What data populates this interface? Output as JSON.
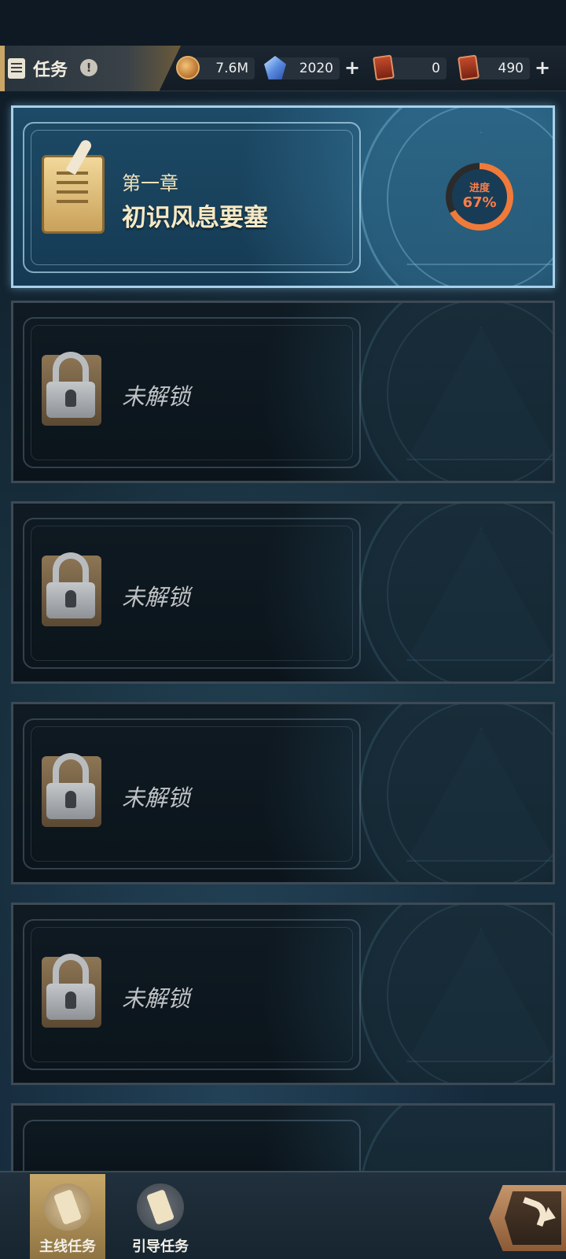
{
  "header": {
    "title": "任务",
    "info_symbol": "!",
    "resources": [
      {
        "icon": "coin-icon",
        "value": "7.6M",
        "has_plus": false
      },
      {
        "icon": "gem-icon",
        "value": "2020",
        "has_plus": true
      },
      {
        "icon": "ticket-icon",
        "value": "0",
        "has_plus": false
      },
      {
        "icon": "ticket-icon",
        "value": "490",
        "has_plus": true
      }
    ],
    "plus_symbol": "+"
  },
  "chapters": [
    {
      "state": "unlocked",
      "number": "第一章",
      "name": "初识风息要塞",
      "progress_label": "进度",
      "progress_text": "67%",
      "progress": 0.67
    },
    {
      "state": "locked",
      "label": "未解锁"
    },
    {
      "state": "locked",
      "label": "未解锁"
    },
    {
      "state": "locked",
      "label": "未解锁"
    },
    {
      "state": "locked",
      "label": "未解锁"
    }
  ],
  "bottom_nav": {
    "tabs": [
      {
        "label": "主线任务",
        "active": true
      },
      {
        "label": "引导任务",
        "active": false
      }
    ]
  },
  "colors": {
    "progress": "#f07a3a",
    "accent_gold": "#c9a566",
    "active_card_border": "#a8d0ea"
  }
}
